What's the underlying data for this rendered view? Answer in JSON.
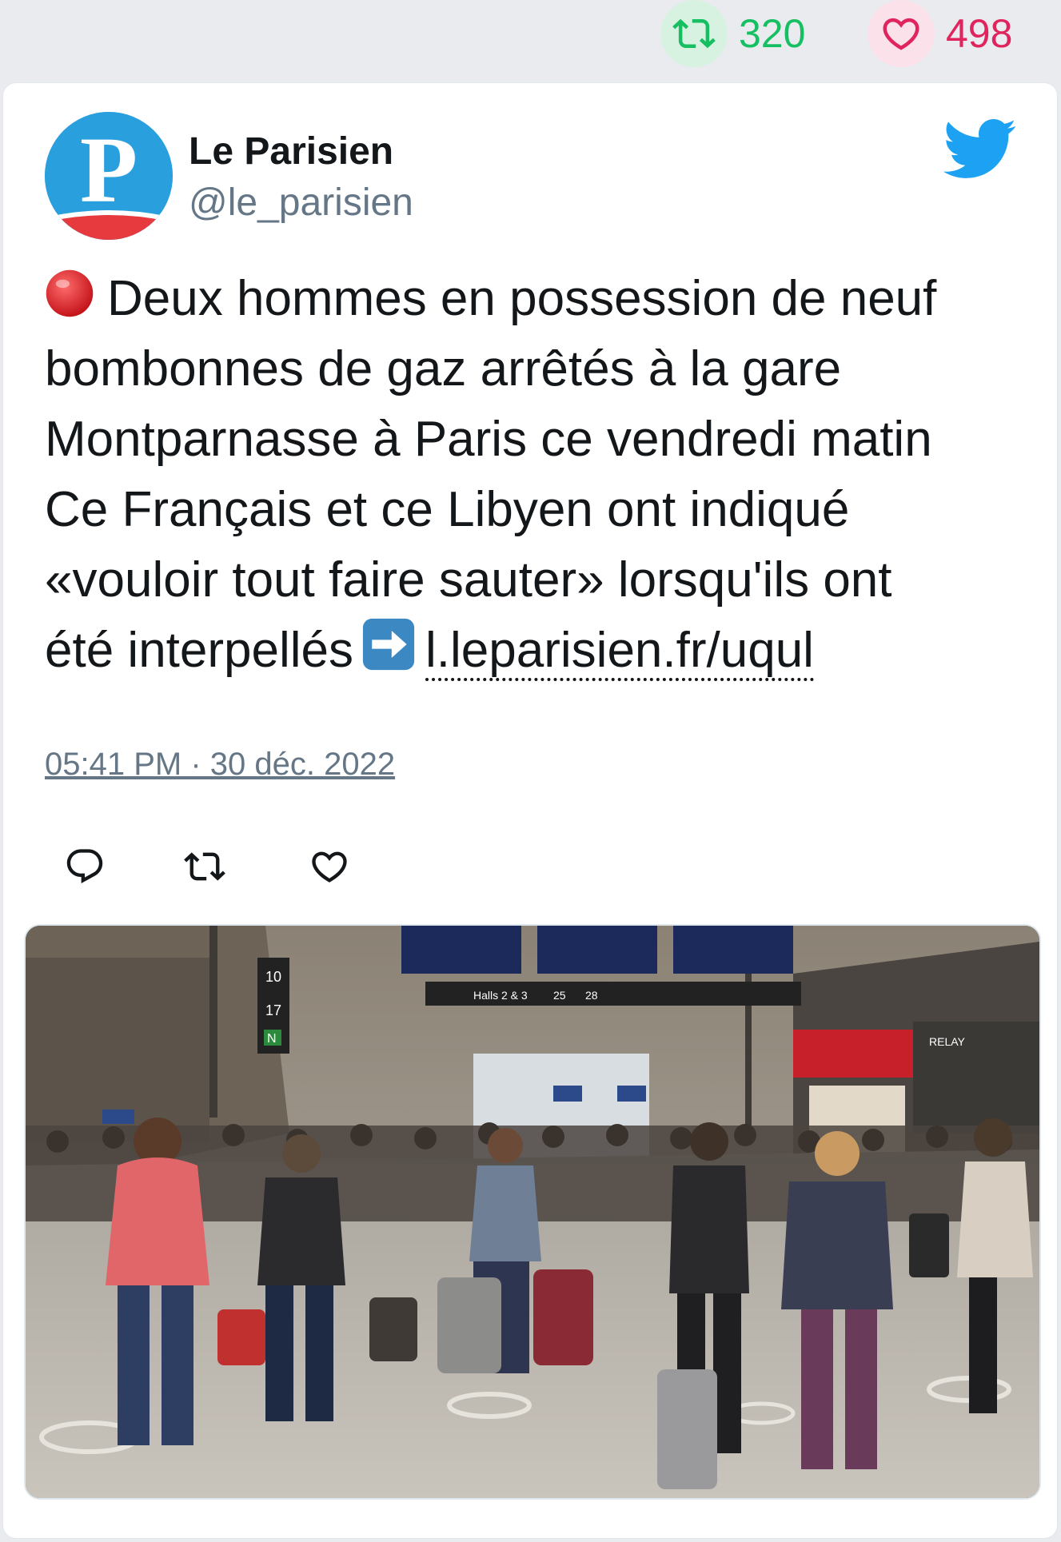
{
  "stats": {
    "retweets": "320",
    "likes": "498",
    "retweet_icon": "retweet-icon",
    "like_icon": "heart-icon",
    "retweet_color": "#17bf63",
    "like_color": "#e0245e"
  },
  "tweet": {
    "display_name": "Le Parisien",
    "handle": "@le_parisien",
    "avatar_letter": "P",
    "lines": [
      "Deux hommes en possession de neuf",
      "bombonnes de gaz arrêtés à la gare",
      "Montparnasse à Paris ce vendredi matin",
      "Ce Français et ce Libyen ont indiqué",
      "«vouloir tout faire sauter» lorsqu'ils ont",
      "été interpellés"
    ],
    "link_text": "l.leparisien.fr/uqul",
    "timestamp": "05:41 PM · 30 déc. 2022",
    "twitter_blue": "#1da1f2"
  },
  "photo": {
    "board_labels": [
      "10",
      "17",
      "N",
      "Halls 2 & 3",
      "25",
      "28",
      "RELAY"
    ]
  }
}
